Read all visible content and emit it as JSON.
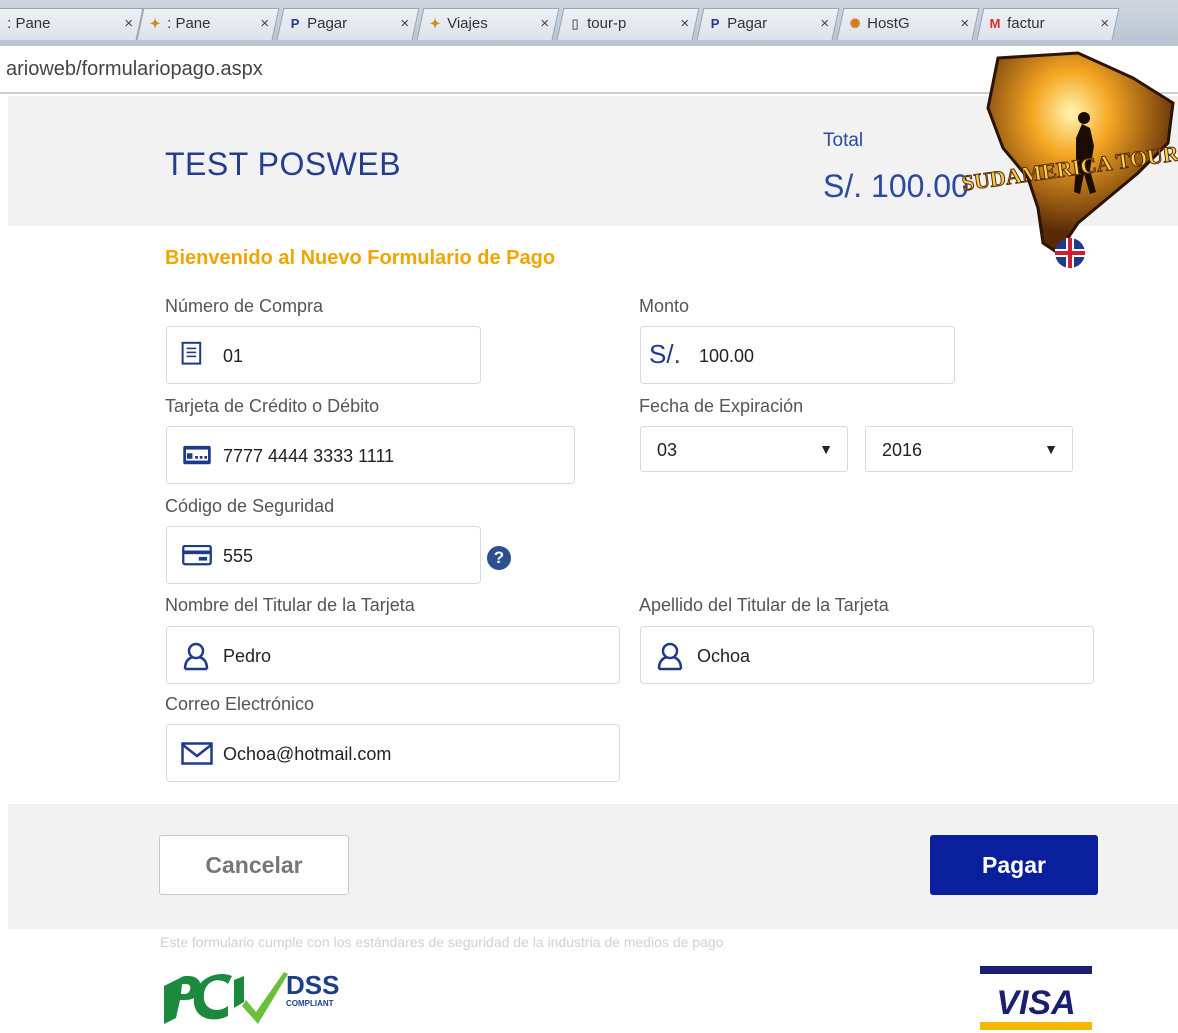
{
  "browser": {
    "tabs": [
      {
        "title": ": Pane",
        "icon": "panel-icon"
      },
      {
        "title": ": Pane",
        "icon": "puzzle-icon"
      },
      {
        "title": "Pagar",
        "icon": "paypal-icon"
      },
      {
        "title": "Viajes",
        "icon": "puzzle-icon"
      },
      {
        "title": "tour-p",
        "icon": "page-icon"
      },
      {
        "title": "Pagar",
        "icon": "paypal-icon"
      },
      {
        "title": "HostG",
        "icon": "hostgator-icon"
      },
      {
        "title": "factur",
        "icon": "gmail-icon"
      }
    ],
    "close_glyph": "×",
    "url": "arioweb/formulariopago.aspx"
  },
  "header": {
    "title": "TEST POSWEB",
    "total_label": "Total",
    "total_value": "S/. 100.00"
  },
  "logo": {
    "text": "SUDAMERICA TOUR"
  },
  "form": {
    "welcome": "Bienvenido al Nuevo Formulario de Pago",
    "purchase_number": {
      "label": "Número de Compra",
      "value": "01"
    },
    "amount": {
      "label": "Monto",
      "prefix": "S/.",
      "value": "100.00"
    },
    "card": {
      "label": "Tarjeta de Crédito o Débito",
      "value": "7777 4444 3333 1111"
    },
    "expiration": {
      "label": "Fecha de Expiración",
      "month": "03",
      "year": "2016"
    },
    "security_code": {
      "label": "Código de Seguridad",
      "value": "555",
      "help": "?"
    },
    "first_name": {
      "label": "Nombre del Titular de la Tarjeta",
      "value": "Pedro"
    },
    "last_name": {
      "label": "Apellido del Titular de la Tarjeta",
      "value": "Ochoa"
    },
    "email": {
      "label": "Correo Electrónico",
      "value": "Ochoa@hotmail.com"
    }
  },
  "actions": {
    "cancel": "Cancelar",
    "pay": "Pagar"
  },
  "footer": {
    "compliance": "Este formulario cumple con los estándares de seguridad de la industria de medios de pago",
    "pci_text": "DSS",
    "pci_sub": "COMPLIANT",
    "visa_text": "VISA"
  },
  "colors": {
    "brand_blue": "#243d8c",
    "accent_orange": "#f0a500",
    "pay_button": "#0a1f9b"
  }
}
